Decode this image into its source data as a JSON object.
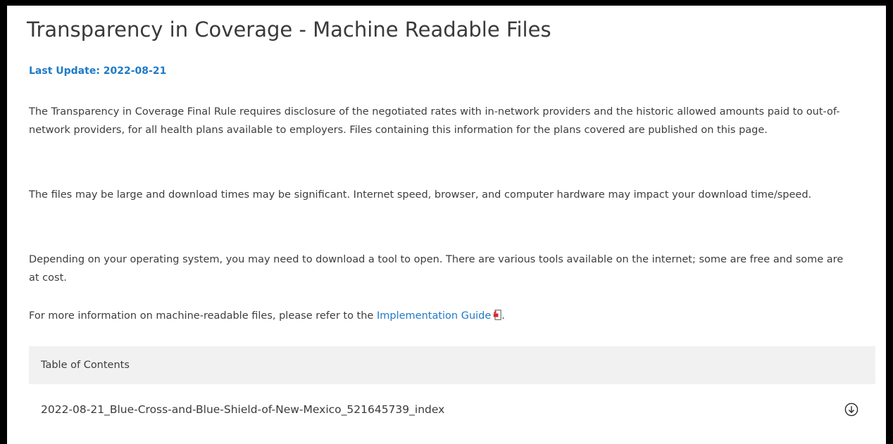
{
  "page": {
    "title": "Transparency in Coverage - Machine Readable Files",
    "last_update": "Last Update: 2022-08-21"
  },
  "content": {
    "paragraph_1": "The Transparency in Coverage Final Rule requires disclosure of the negotiated rates with in-network providers and the historic allowed amounts paid to out-of-network providers, for all health plans available to employers.  Files containing this information for the plans covered are published on this page.",
    "paragraph_2": "The files may be large and download times may be significant. Internet speed, browser, and computer hardware may impact your download time/speed.",
    "paragraph_3": "Depending on your operating system, you may need to download a tool to open.  There are various tools available on the internet; some are free and some are at cost.",
    "paragraph_4_prefix": "For more information on machine-readable files, please refer to the ",
    "implementation_guide_link": "Implementation Guide",
    "paragraph_4_suffix": "."
  },
  "toc": {
    "header": "Table of Contents",
    "files": [
      {
        "name": "2022-08-21_Blue-Cross-and-Blue-Shield-of-New-Mexico_521645739_index",
        "icon": "download-icon"
      }
    ]
  },
  "colors": {
    "link": "#1f7ac7",
    "pdf_icon": "#d9262b",
    "toc_header_bg": "#f1f1f1"
  }
}
